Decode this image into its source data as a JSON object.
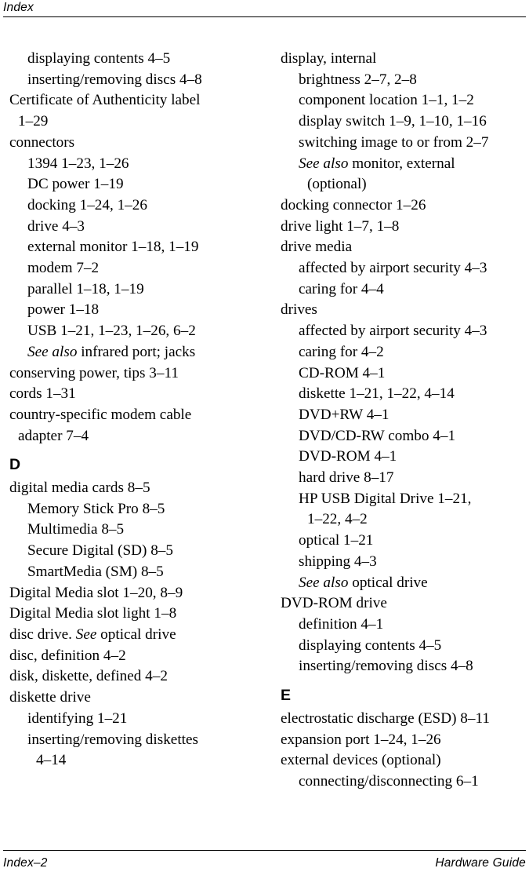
{
  "header": {
    "title": "Index"
  },
  "footer": {
    "page_label": "Index–2",
    "guide_label": "Hardware Guide"
  },
  "columns": [
    {
      "name": "left-column",
      "blocks": [
        {
          "type": "entry",
          "level": 0,
          "indent": "lvl-1",
          "runs": [
            {
              "text": "displaying contents 4–5"
            }
          ]
        },
        {
          "type": "entry",
          "level": 0,
          "indent": "lvl-1",
          "runs": [
            {
              "text": "inserting/removing discs 4–8"
            }
          ]
        },
        {
          "type": "entry",
          "level": 0,
          "indent": "lvl-0",
          "runs": [
            {
              "text": "Certificate of Authenticity label"
            }
          ]
        },
        {
          "type": "entry",
          "level": 0,
          "indent": "lvl-0c",
          "runs": [
            {
              "text": "1–29"
            }
          ]
        },
        {
          "type": "entry",
          "level": 0,
          "indent": "lvl-0",
          "runs": [
            {
              "text": "connectors"
            }
          ]
        },
        {
          "type": "entry",
          "level": 1,
          "indent": "lvl-1",
          "runs": [
            {
              "text": "1394 1–23, 1–26"
            }
          ]
        },
        {
          "type": "entry",
          "level": 1,
          "indent": "lvl-1",
          "runs": [
            {
              "text": "DC power 1–19"
            }
          ]
        },
        {
          "type": "entry",
          "level": 1,
          "indent": "lvl-1",
          "runs": [
            {
              "text": "docking 1–24, 1–26"
            }
          ]
        },
        {
          "type": "entry",
          "level": 1,
          "indent": "lvl-1",
          "runs": [
            {
              "text": "drive 4–3"
            }
          ]
        },
        {
          "type": "entry",
          "level": 1,
          "indent": "lvl-1",
          "runs": [
            {
              "text": "external monitor 1–18, 1–19"
            }
          ]
        },
        {
          "type": "entry",
          "level": 1,
          "indent": "lvl-1",
          "runs": [
            {
              "text": "modem 7–2"
            }
          ]
        },
        {
          "type": "entry",
          "level": 1,
          "indent": "lvl-1",
          "runs": [
            {
              "text": "parallel 1–18, 1–19"
            }
          ]
        },
        {
          "type": "entry",
          "level": 1,
          "indent": "lvl-1",
          "runs": [
            {
              "text": "power 1–18"
            }
          ]
        },
        {
          "type": "entry",
          "level": 1,
          "indent": "lvl-1",
          "runs": [
            {
              "text": "USB 1–21, 1–23, 1–26, 6–2"
            }
          ]
        },
        {
          "type": "entry",
          "level": 1,
          "indent": "lvl-1",
          "runs": [
            {
              "text": "See also",
              "style": "italic"
            },
            {
              "text": " infrared port; jacks"
            }
          ]
        },
        {
          "type": "entry",
          "level": 0,
          "indent": "lvl-0",
          "runs": [
            {
              "text": "conserving power, tips 3–11"
            }
          ]
        },
        {
          "type": "entry",
          "level": 0,
          "indent": "lvl-0",
          "runs": [
            {
              "text": "cords 1–31"
            }
          ]
        },
        {
          "type": "entry",
          "level": 0,
          "indent": "lvl-0",
          "runs": [
            {
              "text": "country-specific modem cable"
            }
          ]
        },
        {
          "type": "entry",
          "level": 0,
          "indent": "lvl-0c",
          "runs": [
            {
              "text": "adapter 7–4"
            }
          ]
        },
        {
          "type": "letter",
          "text": "D"
        },
        {
          "type": "entry",
          "level": 0,
          "indent": "lvl-0",
          "runs": [
            {
              "text": "digital media cards 8–5"
            }
          ]
        },
        {
          "type": "entry",
          "level": 1,
          "indent": "lvl-1",
          "runs": [
            {
              "text": "Memory Stick Pro 8–5"
            }
          ]
        },
        {
          "type": "entry",
          "level": 1,
          "indent": "lvl-1",
          "runs": [
            {
              "text": "Multimedia 8–5"
            }
          ]
        },
        {
          "type": "entry",
          "level": 1,
          "indent": "lvl-1",
          "runs": [
            {
              "text": "Secure Digital (SD) 8–5"
            }
          ]
        },
        {
          "type": "entry",
          "level": 1,
          "indent": "lvl-1",
          "runs": [
            {
              "text": "SmartMedia (SM) 8–5"
            }
          ]
        },
        {
          "type": "entry",
          "level": 0,
          "indent": "lvl-0",
          "runs": [
            {
              "text": "Digital Media slot 1–20, 8–9"
            }
          ]
        },
        {
          "type": "entry",
          "level": 0,
          "indent": "lvl-0",
          "runs": [
            {
              "text": "Digital Media slot light 1–8"
            }
          ]
        },
        {
          "type": "entry",
          "level": 0,
          "indent": "lvl-0",
          "runs": [
            {
              "text": "disc drive. "
            },
            {
              "text": "See",
              "style": "italic"
            },
            {
              "text": " optical drive"
            }
          ]
        },
        {
          "type": "entry",
          "level": 0,
          "indent": "lvl-0",
          "runs": [
            {
              "text": "disc, definition 4–2"
            }
          ]
        },
        {
          "type": "entry",
          "level": 0,
          "indent": "lvl-0",
          "runs": [
            {
              "text": "disk, diskette, defined 4–2"
            }
          ]
        },
        {
          "type": "entry",
          "level": 0,
          "indent": "lvl-0",
          "runs": [
            {
              "text": "diskette drive"
            }
          ]
        },
        {
          "type": "entry",
          "level": 1,
          "indent": "lvl-1",
          "runs": [
            {
              "text": "identifying 1–21"
            }
          ]
        },
        {
          "type": "entry",
          "level": 1,
          "indent": "lvl-1",
          "runs": [
            {
              "text": "inserting/removing diskettes"
            }
          ]
        },
        {
          "type": "entry",
          "level": 1,
          "indent": "lvl-1c",
          "runs": [
            {
              "text": "4–14"
            }
          ]
        }
      ]
    },
    {
      "name": "right-column",
      "blocks": [
        {
          "type": "entry",
          "level": 0,
          "indent": "lvl-0",
          "runs": [
            {
              "text": "display, internal"
            }
          ]
        },
        {
          "type": "entry",
          "level": 1,
          "indent": "lvl-1",
          "runs": [
            {
              "text": "brightness 2–7, 2–8"
            }
          ]
        },
        {
          "type": "entry",
          "level": 1,
          "indent": "lvl-1",
          "runs": [
            {
              "text": "component location 1–1, 1–2"
            }
          ]
        },
        {
          "type": "entry",
          "level": 1,
          "indent": "lvl-1",
          "runs": [
            {
              "text": "display switch 1–9, 1–10, 1–16"
            }
          ]
        },
        {
          "type": "entry",
          "level": 1,
          "indent": "lvl-1",
          "runs": [
            {
              "text": "switching image to or from 2–7"
            }
          ]
        },
        {
          "type": "entry",
          "level": 1,
          "indent": "lvl-1",
          "runs": [
            {
              "text": "See also",
              "style": "italic"
            },
            {
              "text": " monitor, external"
            }
          ]
        },
        {
          "type": "entry",
          "level": 1,
          "indent": "lvl-1c",
          "runs": [
            {
              "text": "(optional)"
            }
          ]
        },
        {
          "type": "entry",
          "level": 0,
          "indent": "lvl-0",
          "runs": [
            {
              "text": "docking connector 1–26"
            }
          ]
        },
        {
          "type": "entry",
          "level": 0,
          "indent": "lvl-0",
          "runs": [
            {
              "text": "drive light 1–7, 1–8"
            }
          ]
        },
        {
          "type": "entry",
          "level": 0,
          "indent": "lvl-0",
          "runs": [
            {
              "text": "drive media"
            }
          ]
        },
        {
          "type": "entry",
          "level": 1,
          "indent": "lvl-1",
          "runs": [
            {
              "text": "affected by airport security 4–3"
            }
          ]
        },
        {
          "type": "entry",
          "level": 1,
          "indent": "lvl-1",
          "runs": [
            {
              "text": "caring for 4–4"
            }
          ]
        },
        {
          "type": "entry",
          "level": 0,
          "indent": "lvl-0",
          "runs": [
            {
              "text": "drives"
            }
          ]
        },
        {
          "type": "entry",
          "level": 1,
          "indent": "lvl-1",
          "runs": [
            {
              "text": "affected by airport security 4–3"
            }
          ]
        },
        {
          "type": "entry",
          "level": 1,
          "indent": "lvl-1",
          "runs": [
            {
              "text": "caring for 4–2"
            }
          ]
        },
        {
          "type": "entry",
          "level": 1,
          "indent": "lvl-1",
          "runs": [
            {
              "text": "CD-ROM 4–1"
            }
          ]
        },
        {
          "type": "entry",
          "level": 1,
          "indent": "lvl-1",
          "runs": [
            {
              "text": "diskette 1–21, 1–22, 4–14"
            }
          ]
        },
        {
          "type": "entry",
          "level": 1,
          "indent": "lvl-1",
          "runs": [
            {
              "text": "DVD+RW 4–1"
            }
          ]
        },
        {
          "type": "entry",
          "level": 1,
          "indent": "lvl-1",
          "runs": [
            {
              "text": "DVD/CD-RW combo 4–1"
            }
          ]
        },
        {
          "type": "entry",
          "level": 1,
          "indent": "lvl-1",
          "runs": [
            {
              "text": "DVD-ROM 4–1"
            }
          ]
        },
        {
          "type": "entry",
          "level": 1,
          "indent": "lvl-1",
          "runs": [
            {
              "text": "hard drive 8–17"
            }
          ]
        },
        {
          "type": "entry",
          "level": 1,
          "indent": "lvl-1",
          "runs": [
            {
              "text": "HP USB Digital Drive 1–21,"
            }
          ]
        },
        {
          "type": "entry",
          "level": 1,
          "indent": "lvl-1c",
          "runs": [
            {
              "text": "1–22, 4–2"
            }
          ]
        },
        {
          "type": "entry",
          "level": 1,
          "indent": "lvl-1",
          "runs": [
            {
              "text": "optical 1–21"
            }
          ]
        },
        {
          "type": "entry",
          "level": 1,
          "indent": "lvl-1",
          "runs": [
            {
              "text": "shipping 4–3"
            }
          ]
        },
        {
          "type": "entry",
          "level": 1,
          "indent": "lvl-1",
          "runs": [
            {
              "text": "See also",
              "style": "italic"
            },
            {
              "text": " optical drive"
            }
          ]
        },
        {
          "type": "entry",
          "level": 0,
          "indent": "lvl-0",
          "runs": [
            {
              "text": "DVD-ROM drive"
            }
          ]
        },
        {
          "type": "entry",
          "level": 1,
          "indent": "lvl-1",
          "runs": [
            {
              "text": "definition 4–1"
            }
          ]
        },
        {
          "type": "entry",
          "level": 1,
          "indent": "lvl-1",
          "runs": [
            {
              "text": "displaying contents 4–5"
            }
          ]
        },
        {
          "type": "entry",
          "level": 1,
          "indent": "lvl-1",
          "runs": [
            {
              "text": "inserting/removing discs 4–8"
            }
          ]
        },
        {
          "type": "letter",
          "text": "E"
        },
        {
          "type": "entry",
          "level": 0,
          "indent": "lvl-0",
          "runs": [
            {
              "text": "electrostatic discharge (ESD) 8–11"
            }
          ]
        },
        {
          "type": "entry",
          "level": 0,
          "indent": "lvl-0",
          "runs": [
            {
              "text": "expansion port 1–24, 1–26"
            }
          ]
        },
        {
          "type": "entry",
          "level": 0,
          "indent": "lvl-0",
          "runs": [
            {
              "text": "external devices (optional)"
            }
          ]
        },
        {
          "type": "entry",
          "level": 1,
          "indent": "lvl-1",
          "runs": [
            {
              "text": "connecting/disconnecting 6–1"
            }
          ]
        }
      ]
    }
  ]
}
